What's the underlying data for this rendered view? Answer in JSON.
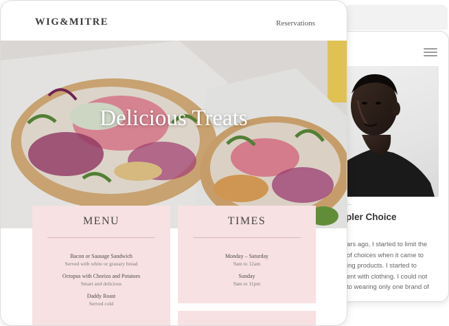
{
  "front": {
    "header": {
      "logo": "WIG&MITRE",
      "nav_reservations": "Reservations"
    },
    "hero": {
      "title": "Delicious Treats"
    },
    "menu_card": {
      "heading": "MENU",
      "items": [
        {
          "name": "Bacon or Sausage Sandwich",
          "desc": "Served with white or granary bread"
        },
        {
          "name": "Octopus with Chorizo and Potatoes",
          "desc": "Smart and delicious"
        },
        {
          "name": "Daddy Roast",
          "desc": "Served cold"
        }
      ]
    },
    "times_card": {
      "heading": "TIMES",
      "items": [
        {
          "name": "Monday – Saturday",
          "desc": "9am to 12am"
        },
        {
          "name": "Sunday",
          "desc": "9am to 11pm"
        }
      ]
    }
  },
  "back": {
    "blog": {
      "title": "pler Choice",
      "paragraph_lines": [
        "ars ago, I started to limit the",
        "of choices when it came to",
        "ing products. I started to",
        "ent with clothing. I could not",
        "to wearing only one brand of"
      ]
    }
  },
  "icons": {
    "menu": "hamburger-menu-icon"
  },
  "colors": {
    "card_pink": "#f8e1e3",
    "text_dark": "#3a3a3a"
  }
}
